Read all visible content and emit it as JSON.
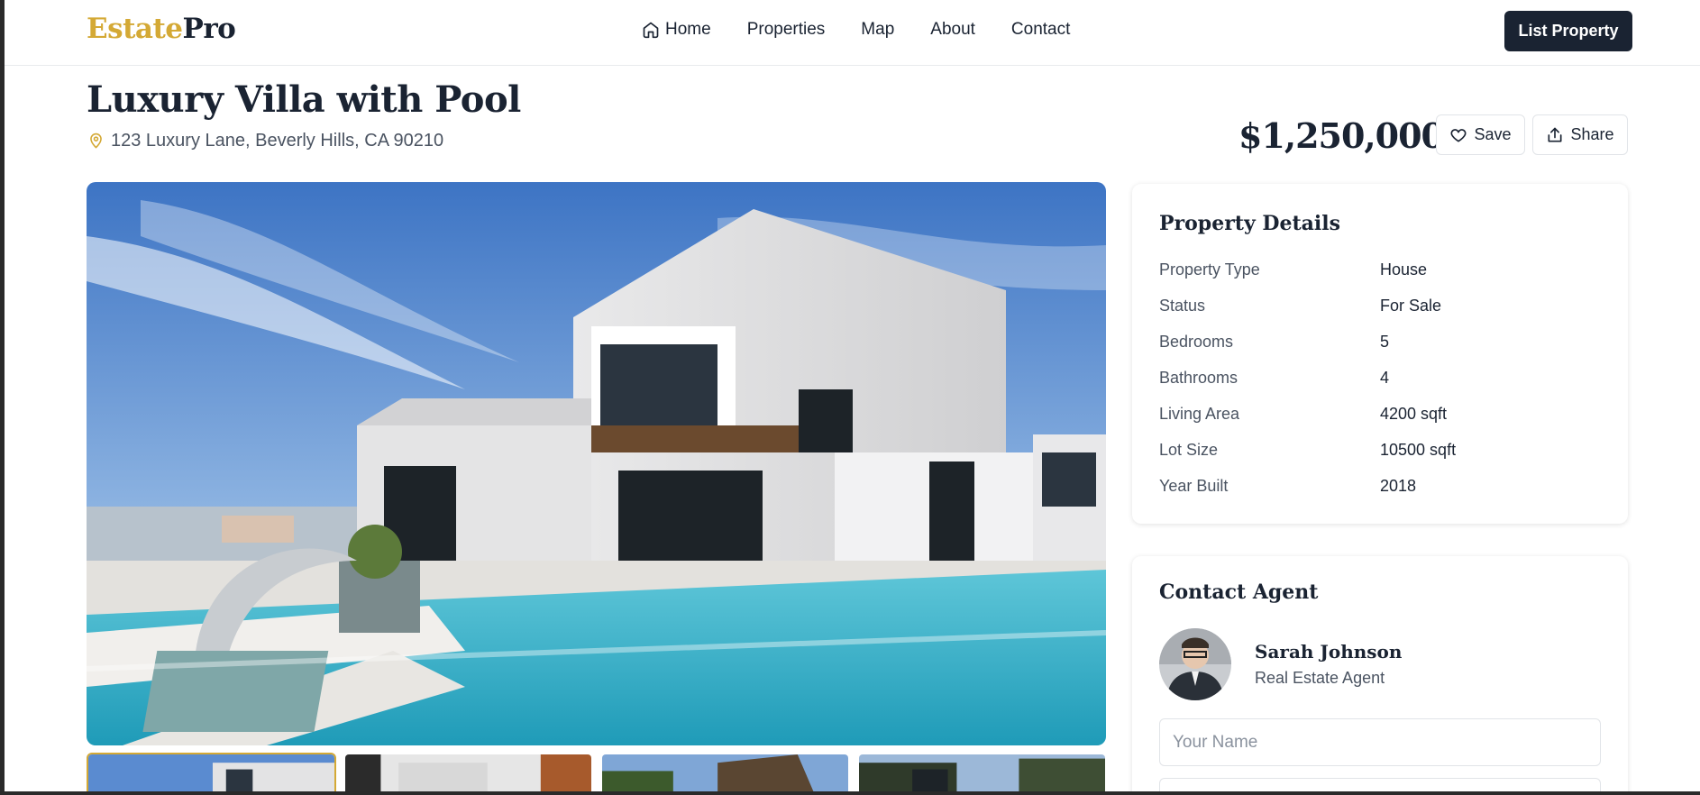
{
  "header": {
    "logo_part1": "Estate",
    "logo_part2": "Pro",
    "nav": [
      {
        "label": "Home",
        "icon": "home-icon"
      },
      {
        "label": "Properties"
      },
      {
        "label": "Map"
      },
      {
        "label": "About"
      },
      {
        "label": "Contact"
      }
    ],
    "list_button": "List Property"
  },
  "listing": {
    "title": "Luxury Villa with Pool",
    "address": "123 Luxury Lane, Beverly Hills, CA 90210",
    "price": "$1,250,000",
    "save_label": "Save",
    "share_label": "Share"
  },
  "details": {
    "title": "Property Details",
    "rows": [
      {
        "label": "Property Type",
        "value": "House"
      },
      {
        "label": "Status",
        "value": "For Sale"
      },
      {
        "label": "Bedrooms",
        "value": "5"
      },
      {
        "label": "Bathrooms",
        "value": "4"
      },
      {
        "label": "Living Area",
        "value": "4200 sqft"
      },
      {
        "label": "Lot Size",
        "value": "10500 sqft"
      },
      {
        "label": "Year Built",
        "value": "2018"
      }
    ]
  },
  "contact": {
    "title": "Contact Agent",
    "agent_name": "Sarah Johnson",
    "agent_role": "Real Estate Agent",
    "name_placeholder": "Your Name"
  },
  "colors": {
    "brand_gold": "#d4a935",
    "navy": "#1a2332",
    "muted_text": "#4a5361"
  }
}
